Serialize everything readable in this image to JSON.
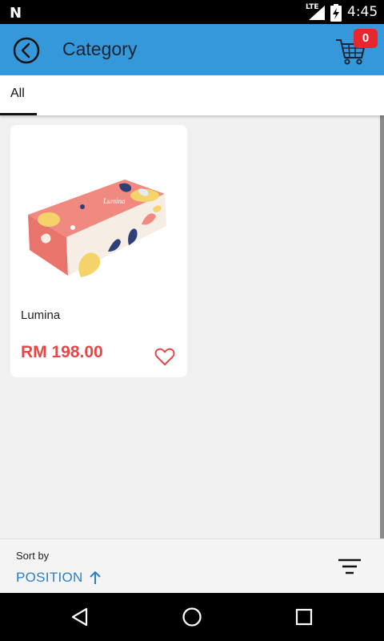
{
  "status_bar": {
    "network_type": "LTE",
    "time": "4:45",
    "icons": [
      "n-notification-icon",
      "signal-icon",
      "battery-icon"
    ]
  },
  "app_bar": {
    "title": "Category",
    "cart_count": "0",
    "background": "#3498db"
  },
  "tabs": [
    {
      "label": "All",
      "selected": true
    }
  ],
  "products": [
    {
      "name": "Lumina",
      "price": "RM 198.00",
      "image": "tissue-box-product-image",
      "favorited": false
    }
  ],
  "sort": {
    "caption": "Sort by",
    "value": "POSITION",
    "direction": "ascending"
  },
  "colors": {
    "accent": "#3498db",
    "price": "#e84545",
    "badge": "#e8262d",
    "sort_value": "#2a7fc9"
  }
}
